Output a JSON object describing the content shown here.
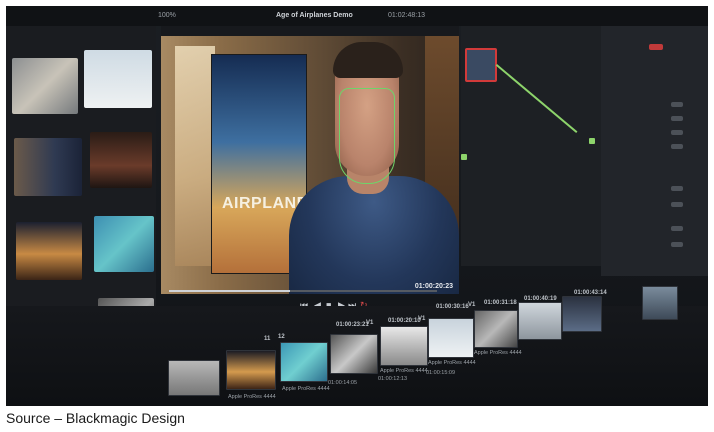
{
  "titlebar": {
    "title": "Age of Airplanes Demo",
    "timecode": "01:02:48:13",
    "zoom": "100%"
  },
  "viewer": {
    "timecode": "01:00:20:23",
    "poster_text": "AIRPLANES",
    "progress": 0.45
  },
  "transport": {
    "skip_back": "⏮",
    "step_back": "◀",
    "stop": "■",
    "play": "▶",
    "skip_forward": "⏭",
    "loop": "↻"
  },
  "timeline": {
    "timecodes": [
      "01:00:23:21",
      "01:00:20:10",
      "01:00:30:16",
      "01:00:31:18",
      "01:00:40:19",
      "01:00:43:14"
    ],
    "track_tags": [
      "V1",
      "V1",
      "V1",
      "11",
      "12"
    ],
    "clip_labels": [
      "Apple ProRes 4444",
      "Apple ProRes 4444",
      "Apple ProRes 4444",
      "Apple ProRes 4444",
      "Apple ProRes 4444"
    ],
    "lower_timecodes": [
      "01:00:14:05",
      "01:00:12:13",
      "01:00:15:09"
    ]
  },
  "colors": {
    "tracker_green": "#6fd46a",
    "node_border_red": "#d23a3a",
    "accent_red": "#c13a3a"
  },
  "caption": "Source – Blackmagic Design"
}
